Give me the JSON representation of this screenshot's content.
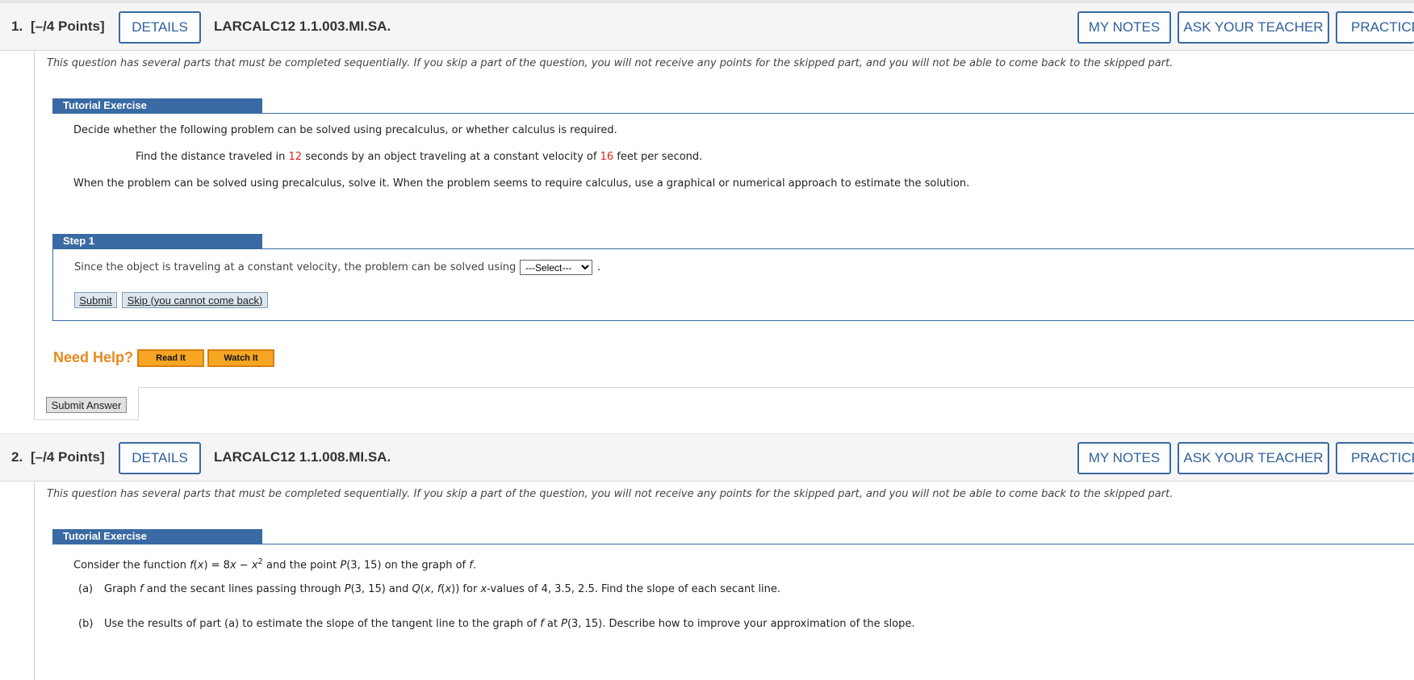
{
  "questions": [
    {
      "number": "1.",
      "points": "[–/4 Points]",
      "details_label": "DETAILS",
      "code": "LARCALC12 1.1.003.MI.SA.",
      "my_notes_label": "MY NOTES",
      "ask_teacher_label": "ASK YOUR TEACHER",
      "practice_label": "PRACTICE ANOTHER",
      "intro": "This question has several parts that must be completed sequentially. If you skip a part of the question, you will not receive any points for the skipped part, and you will not be able to come back to the skipped part.",
      "tutorial_title": "Tutorial Exercise",
      "problem_line1": "Decide whether the following problem can be solved using precalculus, or whether calculus is required.",
      "problem_line2_a": "Find the distance traveled in ",
      "problem_line2_n1": "12",
      "problem_line2_b": " seconds by an object traveling at a constant velocity of ",
      "problem_line2_n2": "16",
      "problem_line2_c": " feet per second.",
      "problem_line3": "When the problem can be solved using precalculus, solve it. When the problem seems to require calculus, use a graphical or numerical approach to estimate the solution.",
      "step_title": "Step 1",
      "step_text": "Since the object is traveling at a constant velocity, the problem can be solved using",
      "step_text_end": ".",
      "select_value": "---Select---",
      "submit_label": "Submit",
      "skip_label": "Skip (you cannot come back)",
      "need_help": "Need Help?",
      "read_it": "Read It",
      "watch_it": "Watch It",
      "submit_answer": "Submit Answer"
    },
    {
      "number": "2.",
      "points": "[–/4 Points]",
      "details_label": "DETAILS",
      "code": "LARCALC12 1.1.008.MI.SA.",
      "my_notes_label": "MY NOTES",
      "ask_teacher_label": "ASK YOUR TEACHER",
      "practice_label": "PRACTICE ANOTHER",
      "intro": "This question has several parts that must be completed sequentially. If you skip a part of the question, you will not receive any points for the skipped part, and you will not be able to come back to the skipped part.",
      "tutorial_title": "Tutorial Exercise",
      "consider": {
        "a": "Consider the function ",
        "f": "f",
        "b": "(",
        "x1": "x",
        "c": ") = 8",
        "x2": "x",
        "d": " − ",
        "x3": "x",
        "sup": "2",
        "e": " and the point ",
        "P": "P",
        "g": "(3, 15) on the graph of ",
        "f2": "f",
        "h": "."
      },
      "part_a_label": "(a)",
      "part_a": {
        "a": "Graph ",
        "f": "f",
        "b": " and the secant lines passing through ",
        "P": "P",
        "c": "(3, 15) and ",
        "Q": "Q",
        "d": "(",
        "x": "x",
        "e": ", ",
        "f2": "f",
        "g": "(",
        "x2": "x",
        "h": ")) for ",
        "x3": "x",
        "i": "-values of 4, 3.5, 2.5. Find the slope of each secant line."
      },
      "part_b_label": "(b)",
      "part_b": {
        "a": "Use the results of part (a) to estimate the slope of the tangent line to the graph of ",
        "f": "f",
        "b": " at ",
        "P": "P",
        "c": "(3, 15). Describe how to improve your approximation of the slope."
      }
    }
  ]
}
